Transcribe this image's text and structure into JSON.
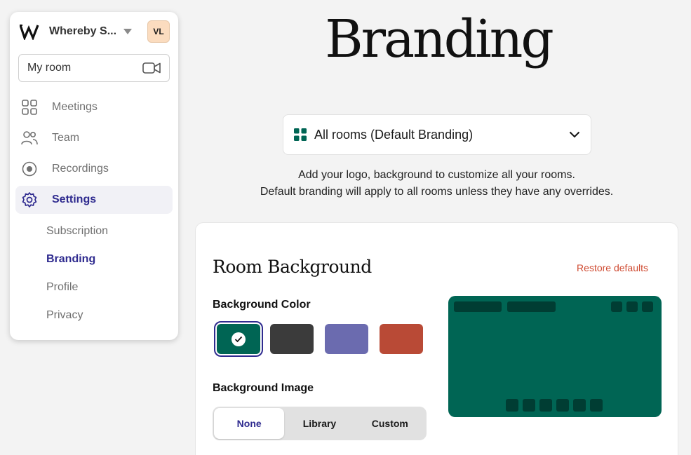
{
  "sidebar": {
    "org_name": "Whereby S...",
    "avatar_initials": "VL",
    "room_label": "My room",
    "nav": [
      {
        "label": "Meetings"
      },
      {
        "label": "Team"
      },
      {
        "label": "Recordings"
      },
      {
        "label": "Settings"
      }
    ],
    "settings_sub": [
      {
        "label": "Subscription"
      },
      {
        "label": "Branding"
      },
      {
        "label": "Profile"
      },
      {
        "label": "Privacy"
      }
    ]
  },
  "main": {
    "title": "Branding",
    "room_select": {
      "label": "All rooms (Default Branding)"
    },
    "description_line1": "Add your logo, background to customize all your rooms.",
    "description_line2": "Default branding will apply to all rooms unless they have any overrides.",
    "card": {
      "title": "Room Background",
      "restore_label": "Restore defaults",
      "bg_color_label": "Background Color",
      "swatches": [
        "#006554",
        "#3b3b3b",
        "#6b6baf",
        "#b94a36"
      ],
      "selected_swatch": 0,
      "bg_image_label": "Background Image",
      "image_options": [
        "None",
        "Library",
        "Custom"
      ],
      "selected_image_option": "None"
    }
  },
  "colors": {
    "accent": "#2f2b8f",
    "restore": "#cf4b32",
    "preview_bg": "#006554",
    "brand_green": "#006554"
  },
  "icons": {
    "logo": "whereby-logo-icon",
    "caret": "caret-down-icon",
    "camera": "video-camera-icon",
    "meetings": "grid-icon",
    "team": "people-icon",
    "recordings": "record-icon",
    "settings": "gear-icon",
    "dropdown": "chevron-down-icon",
    "check": "check-icon"
  }
}
